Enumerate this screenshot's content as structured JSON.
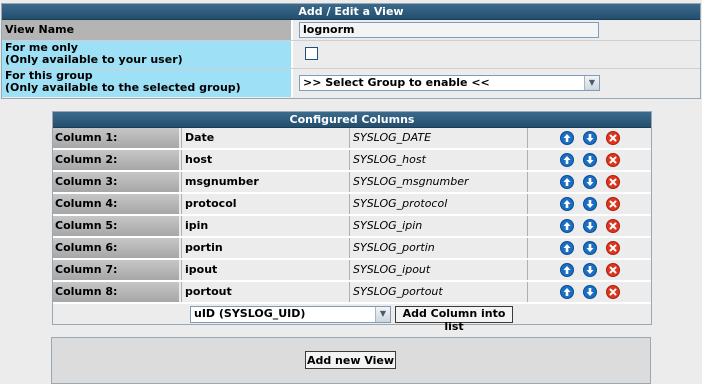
{
  "edit_panel": {
    "title": "Add / Edit a View",
    "view_name_label": "View Name",
    "view_name_value": "lognorm",
    "for_me_label_1": "For me only",
    "for_me_label_2": "(Only available to your user)",
    "for_group_label_1": "For this group",
    "for_group_label_2": "(Only available to the selected group)",
    "group_select_value": ">> Select Group to enable <<"
  },
  "columns_panel": {
    "title": "Configured Columns",
    "rows": [
      {
        "label": "Column 1:",
        "field": "Date",
        "id": "SYSLOG_DATE"
      },
      {
        "label": "Column 2:",
        "field": "host",
        "id": "SYSLOG_host"
      },
      {
        "label": "Column 3:",
        "field": "msgnumber",
        "id": "SYSLOG_msgnumber"
      },
      {
        "label": "Column 4:",
        "field": "protocol",
        "id": "SYSLOG_protocol"
      },
      {
        "label": "Column 5:",
        "field": "ipin",
        "id": "SYSLOG_ipin"
      },
      {
        "label": "Column 6:",
        "field": "portin",
        "id": "SYSLOG_portin"
      },
      {
        "label": "Column 7:",
        "field": "ipout",
        "id": "SYSLOG_ipout"
      },
      {
        "label": "Column 8:",
        "field": "portout",
        "id": "SYSLOG_portout"
      }
    ],
    "add_select_value": "uID (SYSLOG_UID)",
    "add_button_label": "Add Column into list"
  },
  "bottom_panel": {
    "add_view_label": "Add new View"
  },
  "icons": {
    "move_up": "arrow-up-icon",
    "move_down": "arrow-down-icon",
    "delete": "delete-icon"
  },
  "colors": {
    "title_bar": "#2c5a7c",
    "label_cell": "#9ee0f5",
    "arrow_icon": "#1a6fc4",
    "delete_icon": "#e0341c"
  }
}
